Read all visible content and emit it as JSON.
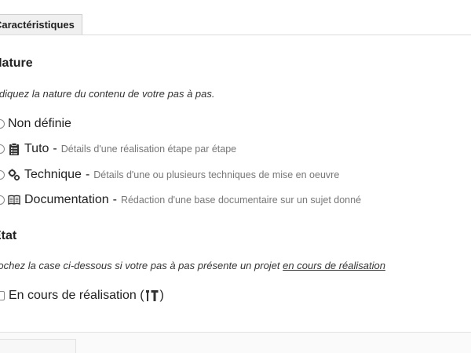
{
  "tab": {
    "label": "Caractéristiques"
  },
  "nature": {
    "heading": "Nature",
    "description": "Indiquez la nature du contenu de votre pas à pas.",
    "options": [
      {
        "title": "Non définie",
        "separator": "",
        "detail": "",
        "icon": ""
      },
      {
        "title": "Tuto",
        "separator": "-",
        "detail": "Détails d'une réalisation étape par étape",
        "icon": "clipboard-icon"
      },
      {
        "title": "Technique",
        "separator": "-",
        "detail": "Détails d'une ou plusieurs techniques de mise en oeuvre",
        "icon": "gears-icon"
      },
      {
        "title": "Documentation",
        "separator": "-",
        "detail": "Rédaction d'une base documentaire sur un sujet donné",
        "icon": "book-icon"
      }
    ]
  },
  "etat": {
    "heading": "Etat",
    "description_prefix": "Cochez la case ci-dessous si votre pas à pas présente un projet",
    "description_link": "en cours de réalisation",
    "checkbox_label_start": "En cours de réalisation (",
    "checkbox_label_end": ")",
    "checkbox_icon": "tools-icon"
  }
}
